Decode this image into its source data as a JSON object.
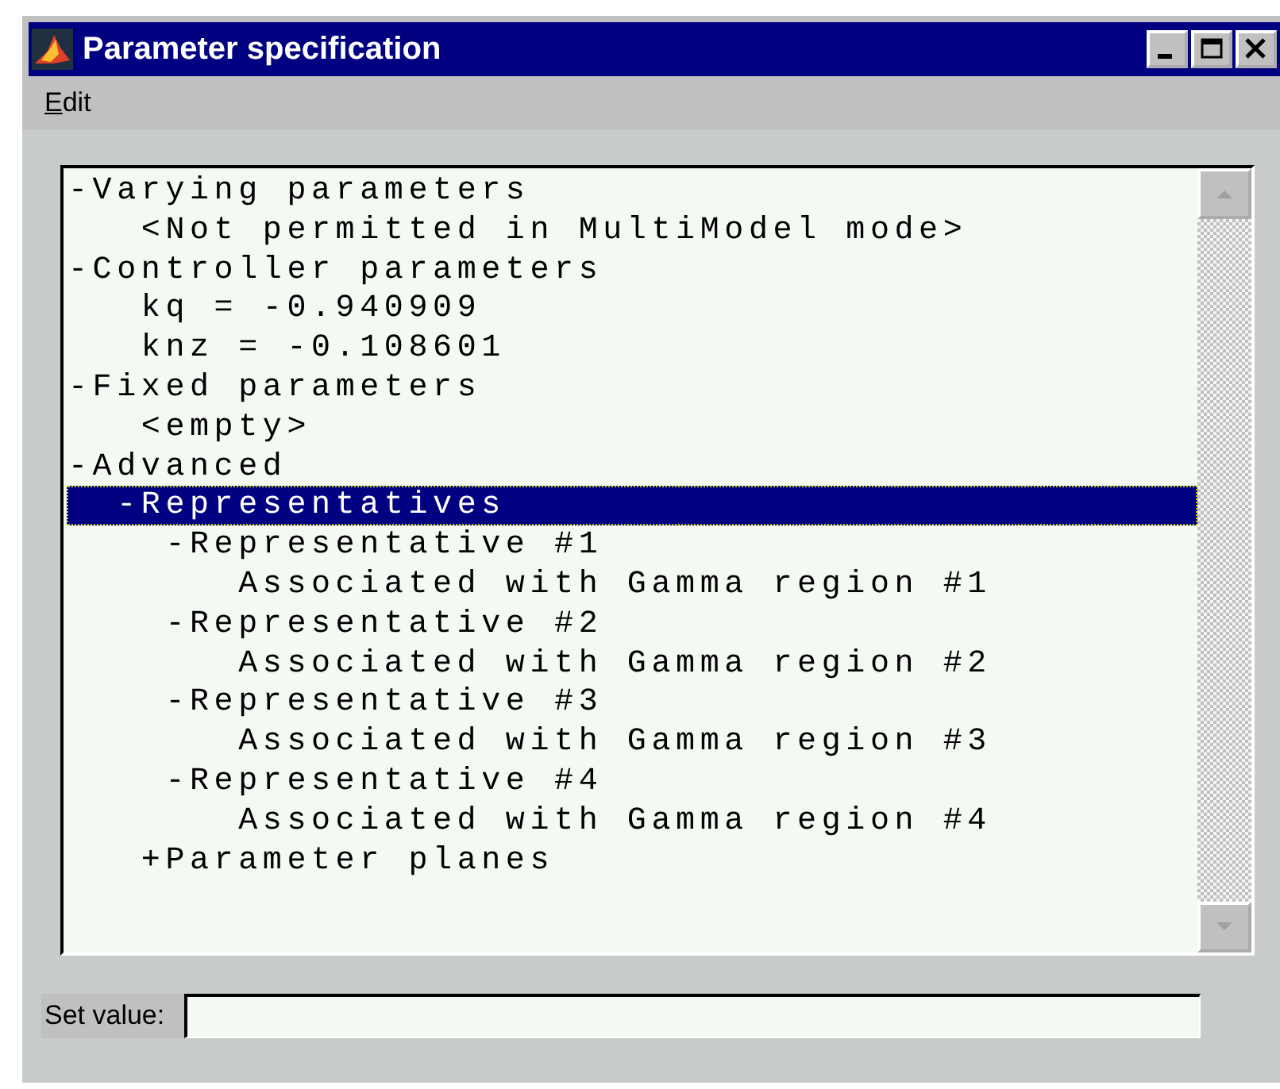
{
  "window": {
    "title": "Parameter specification"
  },
  "menu": [
    {
      "label": "Edit"
    }
  ],
  "tree": [
    {
      "label": "-Varying parameters",
      "selected": false,
      "children": [
        {
          "label": "<Not permitted in MultiModel mode>",
          "selected": false
        }
      ]
    },
    {
      "label": "-Controller parameters",
      "selected": false,
      "children": [
        {
          "label": "kq = -0.940909",
          "selected": false
        },
        {
          "label": "knz = -0.108601",
          "selected": false
        }
      ]
    },
    {
      "label": "-Fixed parameters",
      "selected": false,
      "children": [
        {
          "label": "<empty>",
          "selected": false
        }
      ]
    },
    {
      "label": "-Advanced",
      "selected": false,
      "children": [
        {
          "label": "-Representatives",
          "selected": true,
          "children": [
            {
              "label": "-Representative #1",
              "selected": false,
              "children": [
                {
                  "label": "Associated with Gamma region #1",
                  "selected": false
                }
              ]
            },
            {
              "label": "-Representative #2",
              "selected": false,
              "children": [
                {
                  "label": "Associated with Gamma region #2",
                  "selected": false
                }
              ]
            },
            {
              "label": "-Representative #3",
              "selected": false,
              "children": [
                {
                  "label": "Associated with Gamma region #3",
                  "selected": false
                }
              ]
            },
            {
              "label": "-Representative #4",
              "selected": false,
              "children": [
                {
                  "label": "Associated with Gamma region #4",
                  "selected": false
                }
              ]
            }
          ]
        },
        {
          "label": "+Parameter planes",
          "selected": false
        }
      ]
    }
  ],
  "set_value": {
    "label": "Set value:"
  }
}
